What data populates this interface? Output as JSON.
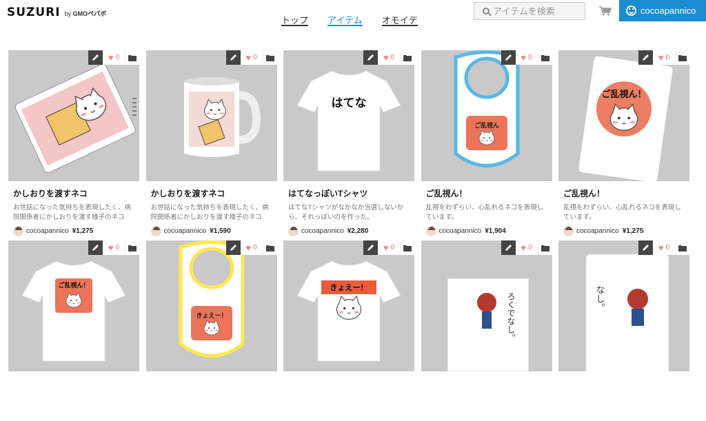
{
  "header": {
    "logo_main": "SUZURI",
    "logo_by": "by",
    "logo_company": "GMOペパボ",
    "tabs": [
      {
        "label": "トップ",
        "active": false
      },
      {
        "label": "アイテム",
        "active": true
      },
      {
        "label": "オモイデ",
        "active": false
      }
    ],
    "search_placeholder": "アイテムを検索",
    "user_name": "cocoapannico"
  },
  "colors": {
    "accent": "#1a8ccf",
    "thumb_bg": "#c9c9c9"
  },
  "items": [
    {
      "title": "かしおりを渡すネコ",
      "desc": "お世話になった気持ちを表現したく、病院関係者にかしおりを渡す様子のネコ",
      "author": "cocoapannico",
      "price": "¥1,275",
      "likes": "0",
      "art": "notebook-cat",
      "art_text": ""
    },
    {
      "title": "かしおりを渡すネコ",
      "desc": "お世話になった気持ちを表現したく、病院関係者にかしおりを渡す様子のネコ",
      "author": "cocoapannico",
      "price": "¥1,590",
      "likes": "0",
      "art": "mug-cat",
      "art_text": ""
    },
    {
      "title": "はてなっぽいTシャツ",
      "desc": "はてなTシャツがなかなか当選しないから、それっぽいのを作った。",
      "author": "cocoapannico",
      "price": "¥2,280",
      "likes": "0",
      "art": "tshirt-text",
      "art_text": "はてな"
    },
    {
      "title": "ご乱視ん！",
      "desc": "乱視をわずらい、心乱れるネコを表現しています。",
      "author": "cocoapannico",
      "price": "¥1,904",
      "likes": "0",
      "art": "bib-blue",
      "art_text": "ご乱視ん"
    },
    {
      "title": "ご乱視ん！",
      "desc": "乱視をわずらい、心乱れるネコを表現しています。",
      "author": "cocoapannico",
      "price": "¥1,275",
      "likes": "0",
      "art": "notebook-ranshi",
      "art_text": "ご乱視ん！"
    },
    {
      "title": "",
      "desc": "",
      "author": "",
      "price": "",
      "likes": "0",
      "art": "tshirt-ranshi",
      "art_text": "ご乱視ん！"
    },
    {
      "title": "",
      "desc": "",
      "author": "",
      "price": "",
      "likes": "0",
      "art": "bib-yellow",
      "art_text": "きょえー！"
    },
    {
      "title": "",
      "desc": "",
      "author": "",
      "price": "",
      "likes": "0",
      "art": "tshirt-kyoe",
      "art_text": "きょえー！"
    },
    {
      "title": "",
      "desc": "",
      "author": "",
      "price": "",
      "likes": "0",
      "art": "card-girl",
      "art_text": "ろくでなし。"
    },
    {
      "title": "",
      "desc": "",
      "author": "",
      "price": "",
      "likes": "0",
      "art": "case-girl",
      "art_text": "なし。"
    }
  ]
}
